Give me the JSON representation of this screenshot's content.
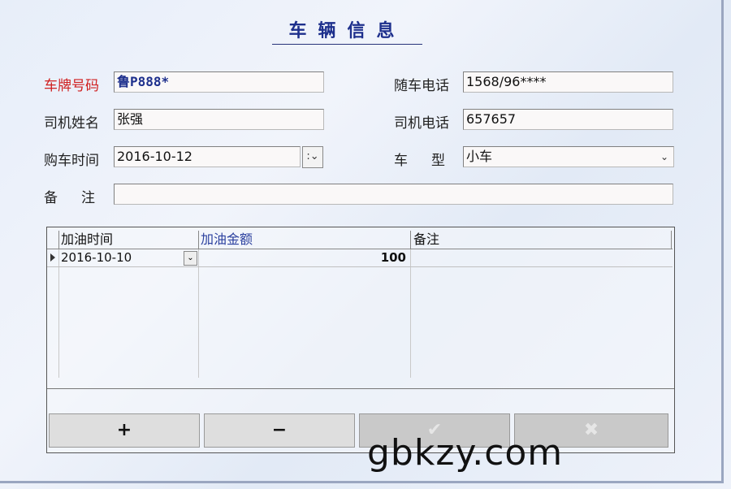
{
  "title": "车辆信息",
  "fields": {
    "plate_label": "车牌号码",
    "plate_value": "鲁P888*",
    "driver_label": "司机姓名",
    "driver_value": "张强",
    "buydate_label": "购车时间",
    "buydate_value": "2016-10-12",
    "note_label": "备　注",
    "note_value": "",
    "carphone_label": "随车电话",
    "carphone_value": "1568/96****",
    "driverphone_label": "司机电话",
    "driverphone_value": "657657",
    "cartype_label": "车　型",
    "cartype_value": "小车"
  },
  "grid": {
    "headers": [
      "加油时间",
      "加油金额",
      "备注"
    ],
    "rows": [
      {
        "date": "2016-10-10",
        "amount": "100",
        "note": ""
      }
    ]
  },
  "buttons": {
    "add": "+",
    "remove": "−",
    "confirm": "✔",
    "cancel": "✖"
  },
  "watermark": "gbkzy.com",
  "colors": {
    "label_red": "#d02020",
    "title_blue": "#1d2f8c"
  }
}
